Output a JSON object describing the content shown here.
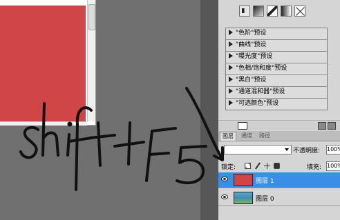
{
  "adjustment_panel": {
    "icons": [
      "levels-icon",
      "curves-icon",
      "exposure-icon",
      "gradient-map-icon",
      "vibrance-icon"
    ],
    "presets": [
      "\"色阶\"预设",
      "\"曲线\"预设",
      "\"曝光度\"预设",
      "\"色相/饱和度\"预设",
      "\"黑白\"预设",
      "\"通道混和器\"预设",
      "\"可选颜色\"预设"
    ]
  },
  "layers_panel": {
    "tabs": [
      "图层",
      "通道",
      "路径"
    ],
    "opacity_label": "不透明度:",
    "opacity_value": "100%",
    "lock_label": "锁定:",
    "fill_label": "填充:",
    "fill_value": "100%",
    "layers": [
      {
        "name": "图层 1",
        "selected": true,
        "thumb_color": "#d04545"
      },
      {
        "name": "图层 0",
        "selected": false,
        "thumb_color": "#4a96b9"
      }
    ]
  },
  "annotation": {
    "text": "shift+F5"
  },
  "colors": {
    "canvas_red": "#d04545",
    "selection_blue": "#3a8ee6"
  }
}
